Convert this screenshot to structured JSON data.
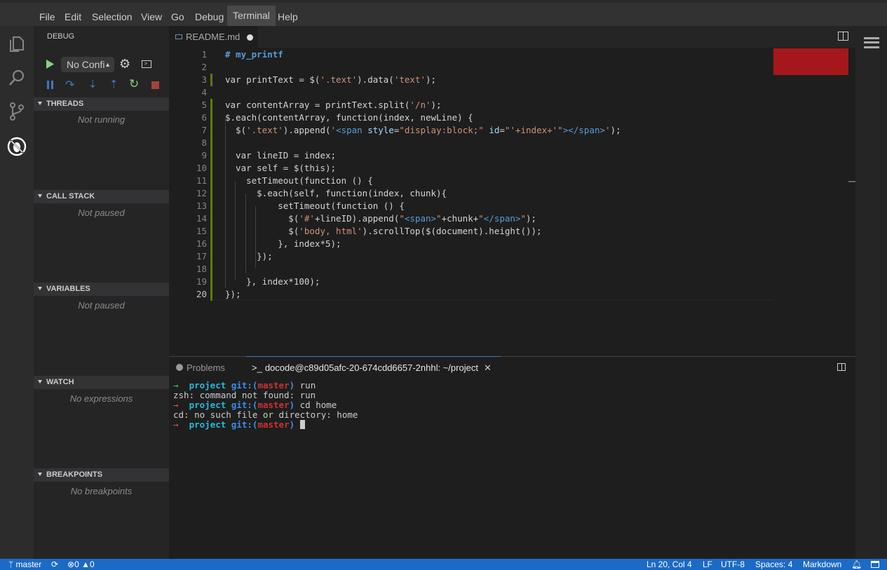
{
  "menu": [
    "File",
    "Edit",
    "Selection",
    "View",
    "Go",
    "Debug",
    "Terminal",
    "Help"
  ],
  "menu_active": "Terminal",
  "sidebar": {
    "title": "DEBUG",
    "config": "No Confi",
    "sections": [
      {
        "title": "THREADS",
        "empty": "Not running"
      },
      {
        "title": "CALL STACK",
        "empty": "Not paused"
      },
      {
        "title": "VARIABLES",
        "empty": "Not paused"
      },
      {
        "title": "WATCH",
        "empty": "No expressions"
      },
      {
        "title": "BREAKPOINTS",
        "empty": "No breakpoints"
      }
    ]
  },
  "editor": {
    "tab": "README.md",
    "current_line": 20,
    "modified_lines": [
      3,
      5,
      6,
      7,
      8,
      9,
      10,
      11,
      12,
      13,
      14,
      15,
      16,
      17,
      18,
      19,
      20
    ],
    "lines": [
      [
        [
          "h",
          "# my_printf"
        ]
      ],
      [],
      [
        [
          "",
          "var printText = $("
        ],
        [
          "s",
          "'.text'"
        ],
        [
          "",
          ").data("
        ],
        [
          "s",
          "'text'"
        ],
        [
          "",
          ");"
        ]
      ],
      [],
      [
        [
          "",
          "var contentArray = printText.split("
        ],
        [
          "s",
          "'/n'"
        ],
        [
          "",
          ");"
        ]
      ],
      [
        [
          "",
          "$.each(contentArray, function(index, newLine) {"
        ]
      ],
      [
        [
          "",
          "  $("
        ],
        [
          "s",
          "'.text'"
        ],
        [
          "",
          ").append("
        ],
        [
          "s",
          "'"
        ],
        [
          "k",
          "<span "
        ],
        [
          "a",
          "style"
        ],
        [
          "",
          "="
        ],
        [
          "s",
          "\"display:block;\" "
        ],
        [
          "a",
          "id"
        ],
        [
          "",
          "="
        ],
        [
          "s",
          "\"'+index+'\""
        ],
        [
          "k",
          "></span>"
        ],
        [
          "s",
          "'"
        ],
        [
          "",
          ");"
        ]
      ],
      [],
      [
        [
          "",
          "  var lineID = index;"
        ]
      ],
      [
        [
          "",
          "  var self = $(this);"
        ]
      ],
      [
        [
          "",
          "    setTimeout(function () {"
        ]
      ],
      [
        [
          "",
          "      $.each(self, function(index, chunk){"
        ]
      ],
      [
        [
          "",
          "          setTimeout(function () {"
        ]
      ],
      [
        [
          "",
          "            $("
        ],
        [
          "s",
          "'#'"
        ],
        [
          "",
          "+lineID).append("
        ],
        [
          "s",
          "\""
        ],
        [
          "k",
          "<span>"
        ],
        [
          "s",
          "\""
        ],
        [
          "",
          "+chunk+"
        ],
        [
          "s",
          "\""
        ],
        [
          "k",
          "</span>"
        ],
        [
          "s",
          "\""
        ],
        [
          "",
          ");"
        ]
      ],
      [
        [
          "",
          "            $("
        ],
        [
          "s",
          "'body, html'"
        ],
        [
          "",
          ").scrollTop($(document).height());"
        ]
      ],
      [
        [
          "",
          "          }, index*5);"
        ]
      ],
      [
        [
          "",
          "      });"
        ]
      ],
      [],
      [
        [
          "",
          "    }, index*100);"
        ]
      ],
      [
        [
          "",
          "});"
        ]
      ]
    ]
  },
  "panel": {
    "problems": "Problems",
    "terminal_tab": "docode@c89d05afc-20-674cdd6657-2nhhl: ~/project",
    "terminal": [
      {
        "arrow": "green",
        "dir": "project",
        "git": "git:(",
        "branch": "master",
        "close": ")",
        "cmd": " run"
      },
      {
        "out": "zsh: command not found: run"
      },
      {
        "arrow": "red",
        "dir": "project",
        "git": "git:(",
        "branch": "master",
        "close": ")",
        "cmd": " cd home"
      },
      {
        "out": "cd: no such file or directory: home"
      },
      {
        "arrow": "red",
        "dir": "project",
        "git": "git:(",
        "branch": "master",
        "close": ")",
        "cmd": " ",
        "cursor": true
      }
    ]
  },
  "status": {
    "branch": "master",
    "errors": "0",
    "warnings": "0",
    "position": "Ln 20, Col 4",
    "eol": "LF",
    "encoding": "UTF-8",
    "indent": "Spaces: 4",
    "language": "Markdown"
  },
  "colors": {
    "status_bar": "#1b6ac6",
    "modified_gutter": "#587c0c",
    "accent_green": "#89d185"
  }
}
